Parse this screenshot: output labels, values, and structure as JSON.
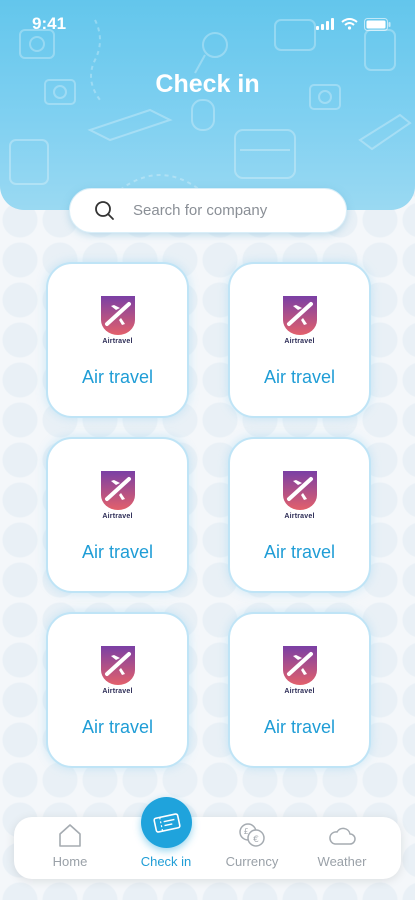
{
  "status_bar": {
    "time": "9:41"
  },
  "header": {
    "title": "Check in"
  },
  "search": {
    "placeholder": "Search for company",
    "value": ""
  },
  "companies": [
    {
      "logo_text": "Airtravel",
      "label": "Air travel"
    },
    {
      "logo_text": "Airtravel",
      "label": "Air travel"
    },
    {
      "logo_text": "Airtravel",
      "label": "Air travel"
    },
    {
      "logo_text": "Airtravel",
      "label": "Air travel"
    },
    {
      "logo_text": "Airtravel",
      "label": "Air travel"
    },
    {
      "logo_text": "Airtravel",
      "label": "Air travel"
    }
  ],
  "tabbar": {
    "items": [
      {
        "label": "Home",
        "icon": "home-icon"
      },
      {
        "label": "Check in",
        "icon": "ticket-icon",
        "active": true
      },
      {
        "label": "Currency",
        "icon": "currency-icon"
      },
      {
        "label": "Weather",
        "icon": "cloud-icon"
      }
    ]
  },
  "colors": {
    "accent": "#1f9dd6",
    "header": "#63c6ec",
    "logo_gradient_top": "#8a3fa0",
    "logo_gradient_bottom": "#e05a6a"
  }
}
